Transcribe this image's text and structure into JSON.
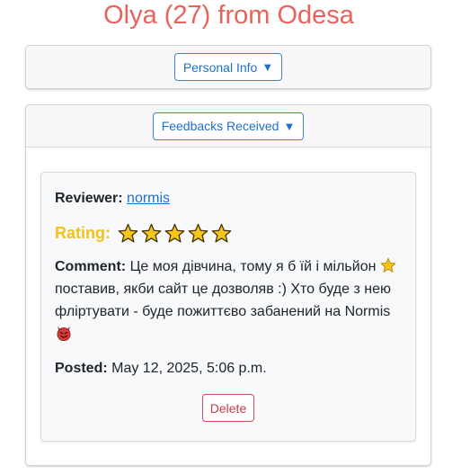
{
  "page": {
    "title": "Olya (27) from Odesa"
  },
  "personal_info": {
    "toggle_label": "Personal Info",
    "caret": "▼"
  },
  "feedbacks": {
    "toggle_label": "Feedbacks Received",
    "caret": "▼",
    "items": [
      {
        "reviewer_label": "Reviewer:",
        "reviewer_name": "normis",
        "rating_label": "Rating:",
        "rating_stars": 5,
        "comment_label": "Comment:",
        "comment_part1": "Це моя дівчина, тому я б їй і мільйон",
        "comment_part2": "поставив, якби сайт це дозволяв :) Хто буде з нею фліртувати - буде пожиттєво забанений на Normis",
        "posted_label": "Posted:",
        "posted_value": "May 12, 2025, 5:06 p.m.",
        "delete_label": "Delete"
      }
    ]
  },
  "colors": {
    "title": "#e8635c",
    "primary": "#1f6fc9",
    "rating_label": "#f2c21b",
    "star": "#f5c518",
    "danger": "#c73b47"
  }
}
